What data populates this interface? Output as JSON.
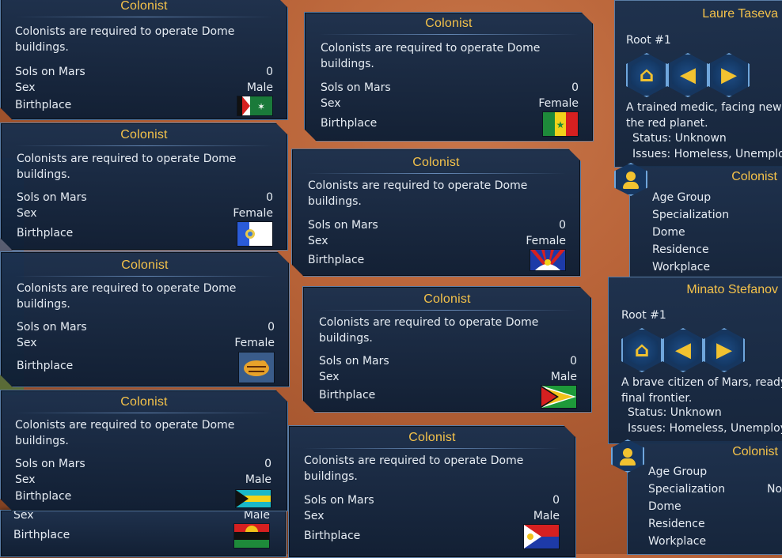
{
  "cards": [
    {
      "title": "Colonist",
      "desc": "Colonists are required to operate Dome buildings.",
      "sols_label": "Sols on Mars",
      "sols": "0",
      "sex_label": "Sex",
      "sex": "Male",
      "birth_label": "Birthplace",
      "flag": "flag-icon-egypt-like"
    },
    {
      "title": "Colonist",
      "desc": "Colonists are required to operate Dome buildings.",
      "sols_label": "Sols on Mars",
      "sols": "0",
      "sex_label": "Sex",
      "sex": "Female",
      "birth_label": "Birthplace",
      "flag": "flag-icon-senegal"
    },
    {
      "title": "Colonist",
      "desc": "Colonists are required to operate Dome buildings.",
      "sols_label": "Sols on Mars",
      "sols": "0",
      "sex_label": "Sex",
      "sex": "Female",
      "birth_label": "Birthplace",
      "flag": "flag-icon-guatemala-like"
    },
    {
      "title": "Colonist",
      "desc": "Colonists are required to operate Dome buildings.",
      "sols_label": "Sols on Mars",
      "sols": "0",
      "sex_label": "Sex",
      "sex": "Female",
      "birth_label": "Birthplace",
      "flag": "flag-icon-tibet"
    },
    {
      "title": "Colonist",
      "desc": "Colonists are required to operate Dome buildings.",
      "sols_label": "Sols on Mars",
      "sols": "0",
      "sex_label": "Sex",
      "sex": "Female",
      "birth_label": "Birthplace",
      "flag": "flag-icon-tiger-emblem"
    },
    {
      "title": "Colonist",
      "desc": "Colonists are required to operate Dome buildings.",
      "sols_label": "Sols on Mars",
      "sols": "0",
      "sex_label": "Sex",
      "sex": "Male",
      "birth_label": "Birthplace",
      "flag": "flag-icon-guyana"
    },
    {
      "title": "Colonist",
      "desc": "Colonists are required to operate Dome buildings.",
      "sols_label": "Sols on Mars",
      "sols": "0",
      "sex_label": "Sex",
      "sex": "Male",
      "birth_label": "Birthplace",
      "flag": "flag-icon-bahamas"
    },
    {
      "title": "Colonist",
      "desc": "Colonists are required to operate Dome buildings.",
      "sols_label": "Sols on Mars",
      "sols": "0",
      "sex_label": "Sex",
      "sex": "Male",
      "birth_label": "Birthplace",
      "flag": "flag-icon-sint-maarten"
    }
  ],
  "peek": {
    "sex_label": "Sex",
    "sex": "Male",
    "birth_label": "Birthplace",
    "flag": "flag-icon-biafra"
  },
  "side1": {
    "name": "Laure Taseva",
    "root": "Root #1",
    "bio1": "A trained medic, facing new c",
    "bio2": "the red planet.",
    "status": "Status: Unknown",
    "issues": "Issues: Homeless, Unemploye",
    "section": "Colonist",
    "items": [
      "Age Group",
      "Specialization",
      "Dome",
      "Residence",
      "Workplace"
    ]
  },
  "side2": {
    "name": "Minato Stefanov",
    "root": "Root #1",
    "bio1": "A brave citizen of Mars, ready",
    "bio2": "final frontier.",
    "status": "Status: Unknown",
    "issues": "Issues: Homeless, Unemploye",
    "section": "Colonist",
    "items": [
      "Age Group",
      "Specialization",
      "Dome",
      "Residence",
      "Workplace"
    ],
    "extra": "No"
  },
  "colors": {
    "accent": "#f4c24a",
    "panel": "#1a304e",
    "border": "#5a7da6",
    "icon": "#f2c230"
  }
}
